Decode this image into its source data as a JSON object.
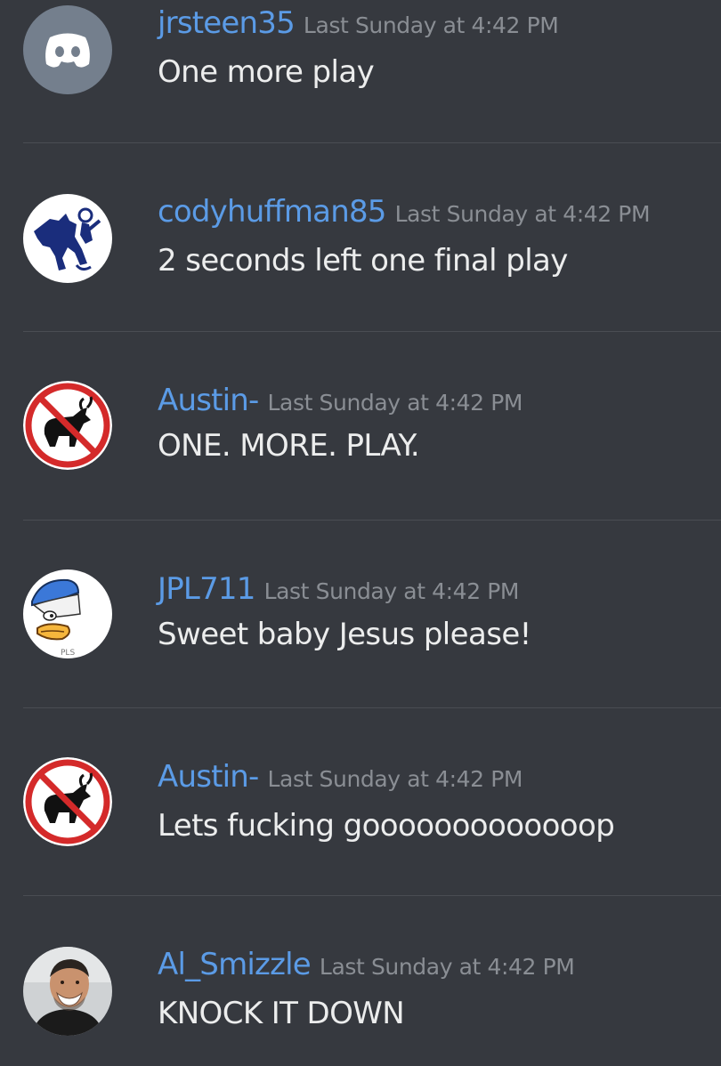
{
  "messages": [
    {
      "username": "jrsteen35",
      "timestamp": "Last Sunday at 4:42 PM",
      "text": "One more play",
      "avatar": "discord-default-avatar"
    },
    {
      "username": "codyhuffman85",
      "timestamp": "Last Sunday at 4:42 PM",
      "text": "2 seconds left one final play",
      "avatar": "bucking-horse-rider-avatar"
    },
    {
      "username": "Austin-",
      "timestamp": "Last Sunday at 4:42 PM",
      "text": "ONE. MORE. PLAY.",
      "avatar": "no-bull-sign-avatar"
    },
    {
      "username": "JPL711",
      "timestamp": "Last Sunday at 4:42 PM",
      "text": "Sweet baby Jesus please!",
      "avatar": "duck-with-blue-cap-avatar",
      "avatar_text": "PLS"
    },
    {
      "username": "Austin-",
      "timestamp": "Last Sunday at 4:42 PM",
      "text": "Lets fucking gooooooooooooop",
      "avatar": "no-bull-sign-avatar"
    },
    {
      "username": "Al_Smizzle",
      "timestamp": "Last Sunday at 4:42 PM",
      "text": "KNOCK IT DOWN",
      "avatar": "man-photo-avatar"
    }
  ],
  "colors": {
    "background": "#36393f",
    "username": "#5b9be6",
    "timestamp": "#8a8e94",
    "text": "#eceded",
    "divider": "#4a4d53"
  }
}
